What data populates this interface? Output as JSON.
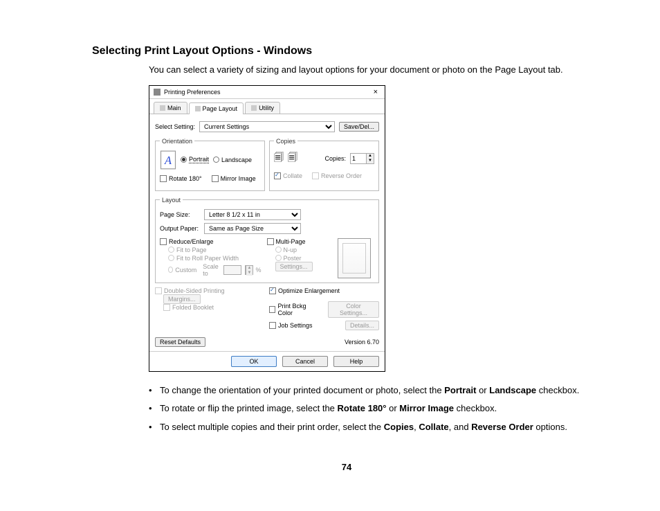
{
  "heading": "Selecting Print Layout Options - Windows",
  "intro": "You can select a variety of sizing and layout options for your document or photo on the Page Layout tab.",
  "dialog": {
    "title": "Printing Preferences",
    "tabs": {
      "main": "Main",
      "page_layout": "Page Layout",
      "utility": "Utility"
    },
    "select_setting_label": "Select Setting:",
    "select_setting_value": "Current Settings",
    "save_del": "Save/Del...",
    "orientation": {
      "legend": "Orientation",
      "portrait": "Portrait",
      "landscape": "Landscape",
      "rotate": "Rotate 180°",
      "mirror": "Mirror Image"
    },
    "copies": {
      "legend": "Copies",
      "label": "Copies:",
      "value": "1",
      "collate": "Collate",
      "reverse": "Reverse Order"
    },
    "layout": {
      "legend": "Layout",
      "page_size_label": "Page Size:",
      "page_size_value": "Letter 8 1/2 x 11 in",
      "output_paper_label": "Output Paper:",
      "output_paper_value": "Same as Page Size",
      "reduce_enlarge": "Reduce/Enlarge",
      "fit_page": "Fit to Page",
      "fit_roll": "Fit to Roll Paper Width",
      "custom": "Custom",
      "scale_to": "Scale to",
      "scale_pct": "%",
      "multi_page": "Multi-Page",
      "nup": "N-up",
      "poster": "Poster",
      "settings_btn": "Settings..."
    },
    "lower": {
      "double_sided": "Double-Sided Printing",
      "margins": "Margins...",
      "folded": "Folded Booklet",
      "optimize": "Optimize Enlargement",
      "print_bckg": "Print Bckg Color",
      "color_settings": "Color Settings...",
      "job_settings": "Job Settings",
      "details": "Details..."
    },
    "reset": "Reset Defaults",
    "version": "Version 6.70",
    "ok": "OK",
    "cancel": "Cancel",
    "help": "Help"
  },
  "bullets": {
    "b1a": "To change the orientation of your printed document or photo, select the ",
    "b1_b_portrait": "Portrait",
    "b1_or": " or ",
    "b1_b_landscape": "Landscape",
    "b1_tail": " checkbox.",
    "b2a": "To rotate or flip the printed image, select the ",
    "b2_b_rotate": "Rotate 180°",
    "b2_or": " or ",
    "b2_b_mirror": "Mirror Image",
    "b2_tail": " checkbox.",
    "b3a": "To select multiple copies and their print order, select the ",
    "b3_b_copies": "Copies",
    "b3_c1": ", ",
    "b3_b_collate": "Collate",
    "b3_c2": ", and ",
    "b3_b_reverse": "Reverse Order",
    "b3_tail": " options."
  },
  "page_number": "74"
}
